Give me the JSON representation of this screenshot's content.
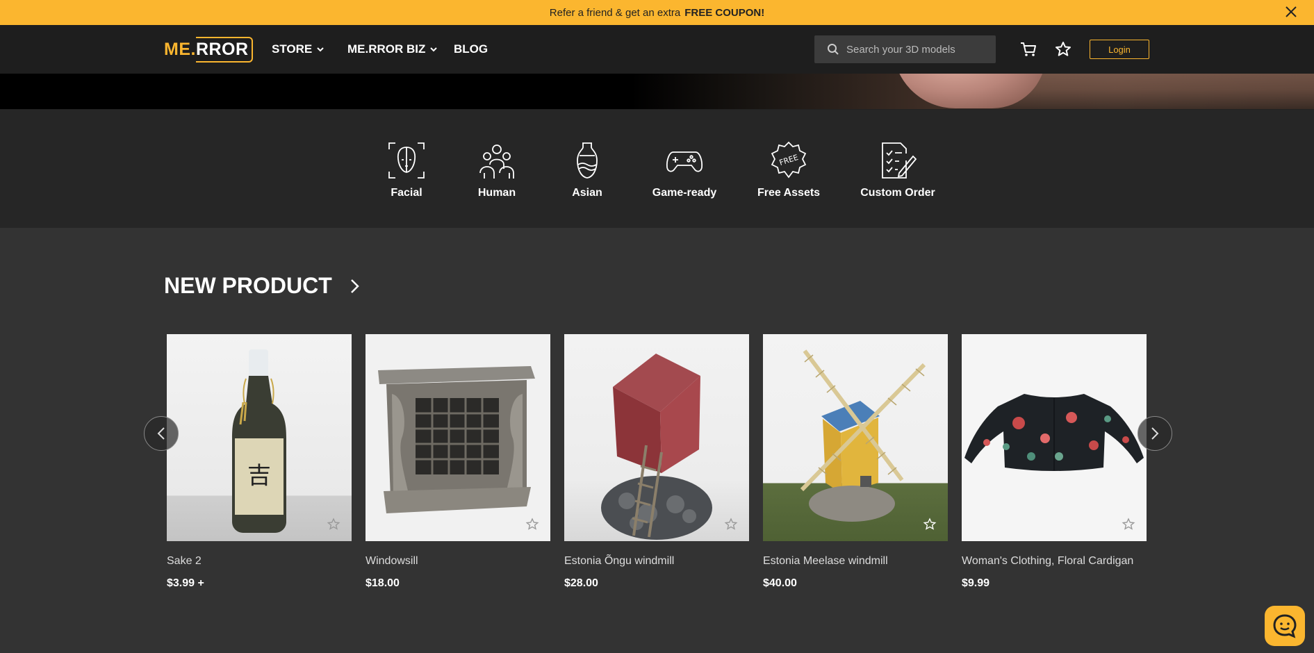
{
  "promo": {
    "text": "Refer a friend & get an extra",
    "highlight": "FREE COUPON!"
  },
  "nav": {
    "logo_me": "ME.",
    "logo_rror": "RROR",
    "menu": [
      {
        "label": "STORE",
        "dropdown": true
      },
      {
        "label": "ME.RROR BIZ",
        "dropdown": true
      },
      {
        "label": "BLOG",
        "dropdown": false
      }
    ],
    "search_placeholder": "Search your 3D models",
    "login_label": "Login"
  },
  "categories": [
    {
      "label": "Facial",
      "icon": "face-scan-icon"
    },
    {
      "label": "Human",
      "icon": "people-icon"
    },
    {
      "label": "Asian",
      "icon": "vase-icon"
    },
    {
      "label": "Game-ready",
      "icon": "gamepad-icon"
    },
    {
      "label": "Free Assets",
      "icon": "free-badge-icon"
    },
    {
      "label": "Custom Order",
      "icon": "checklist-icon"
    }
  ],
  "section": {
    "title": "NEW PRODUCT"
  },
  "products": [
    {
      "name": "Sake 2",
      "price": "$3.99 +"
    },
    {
      "name": "Windowsill",
      "price": "$18.00"
    },
    {
      "name": "Estonia Õngu windmill",
      "price": "$28.00"
    },
    {
      "name": "Estonia Meelase windmill",
      "price": "$40.00"
    },
    {
      "name": "Woman's Clothing, Floral Cardigan",
      "price": "$9.99"
    }
  ],
  "colors": {
    "accent": "#fbb62f",
    "nav_bg": "#1e1e1e",
    "page_bg": "#333333",
    "category_bg": "#262626"
  }
}
